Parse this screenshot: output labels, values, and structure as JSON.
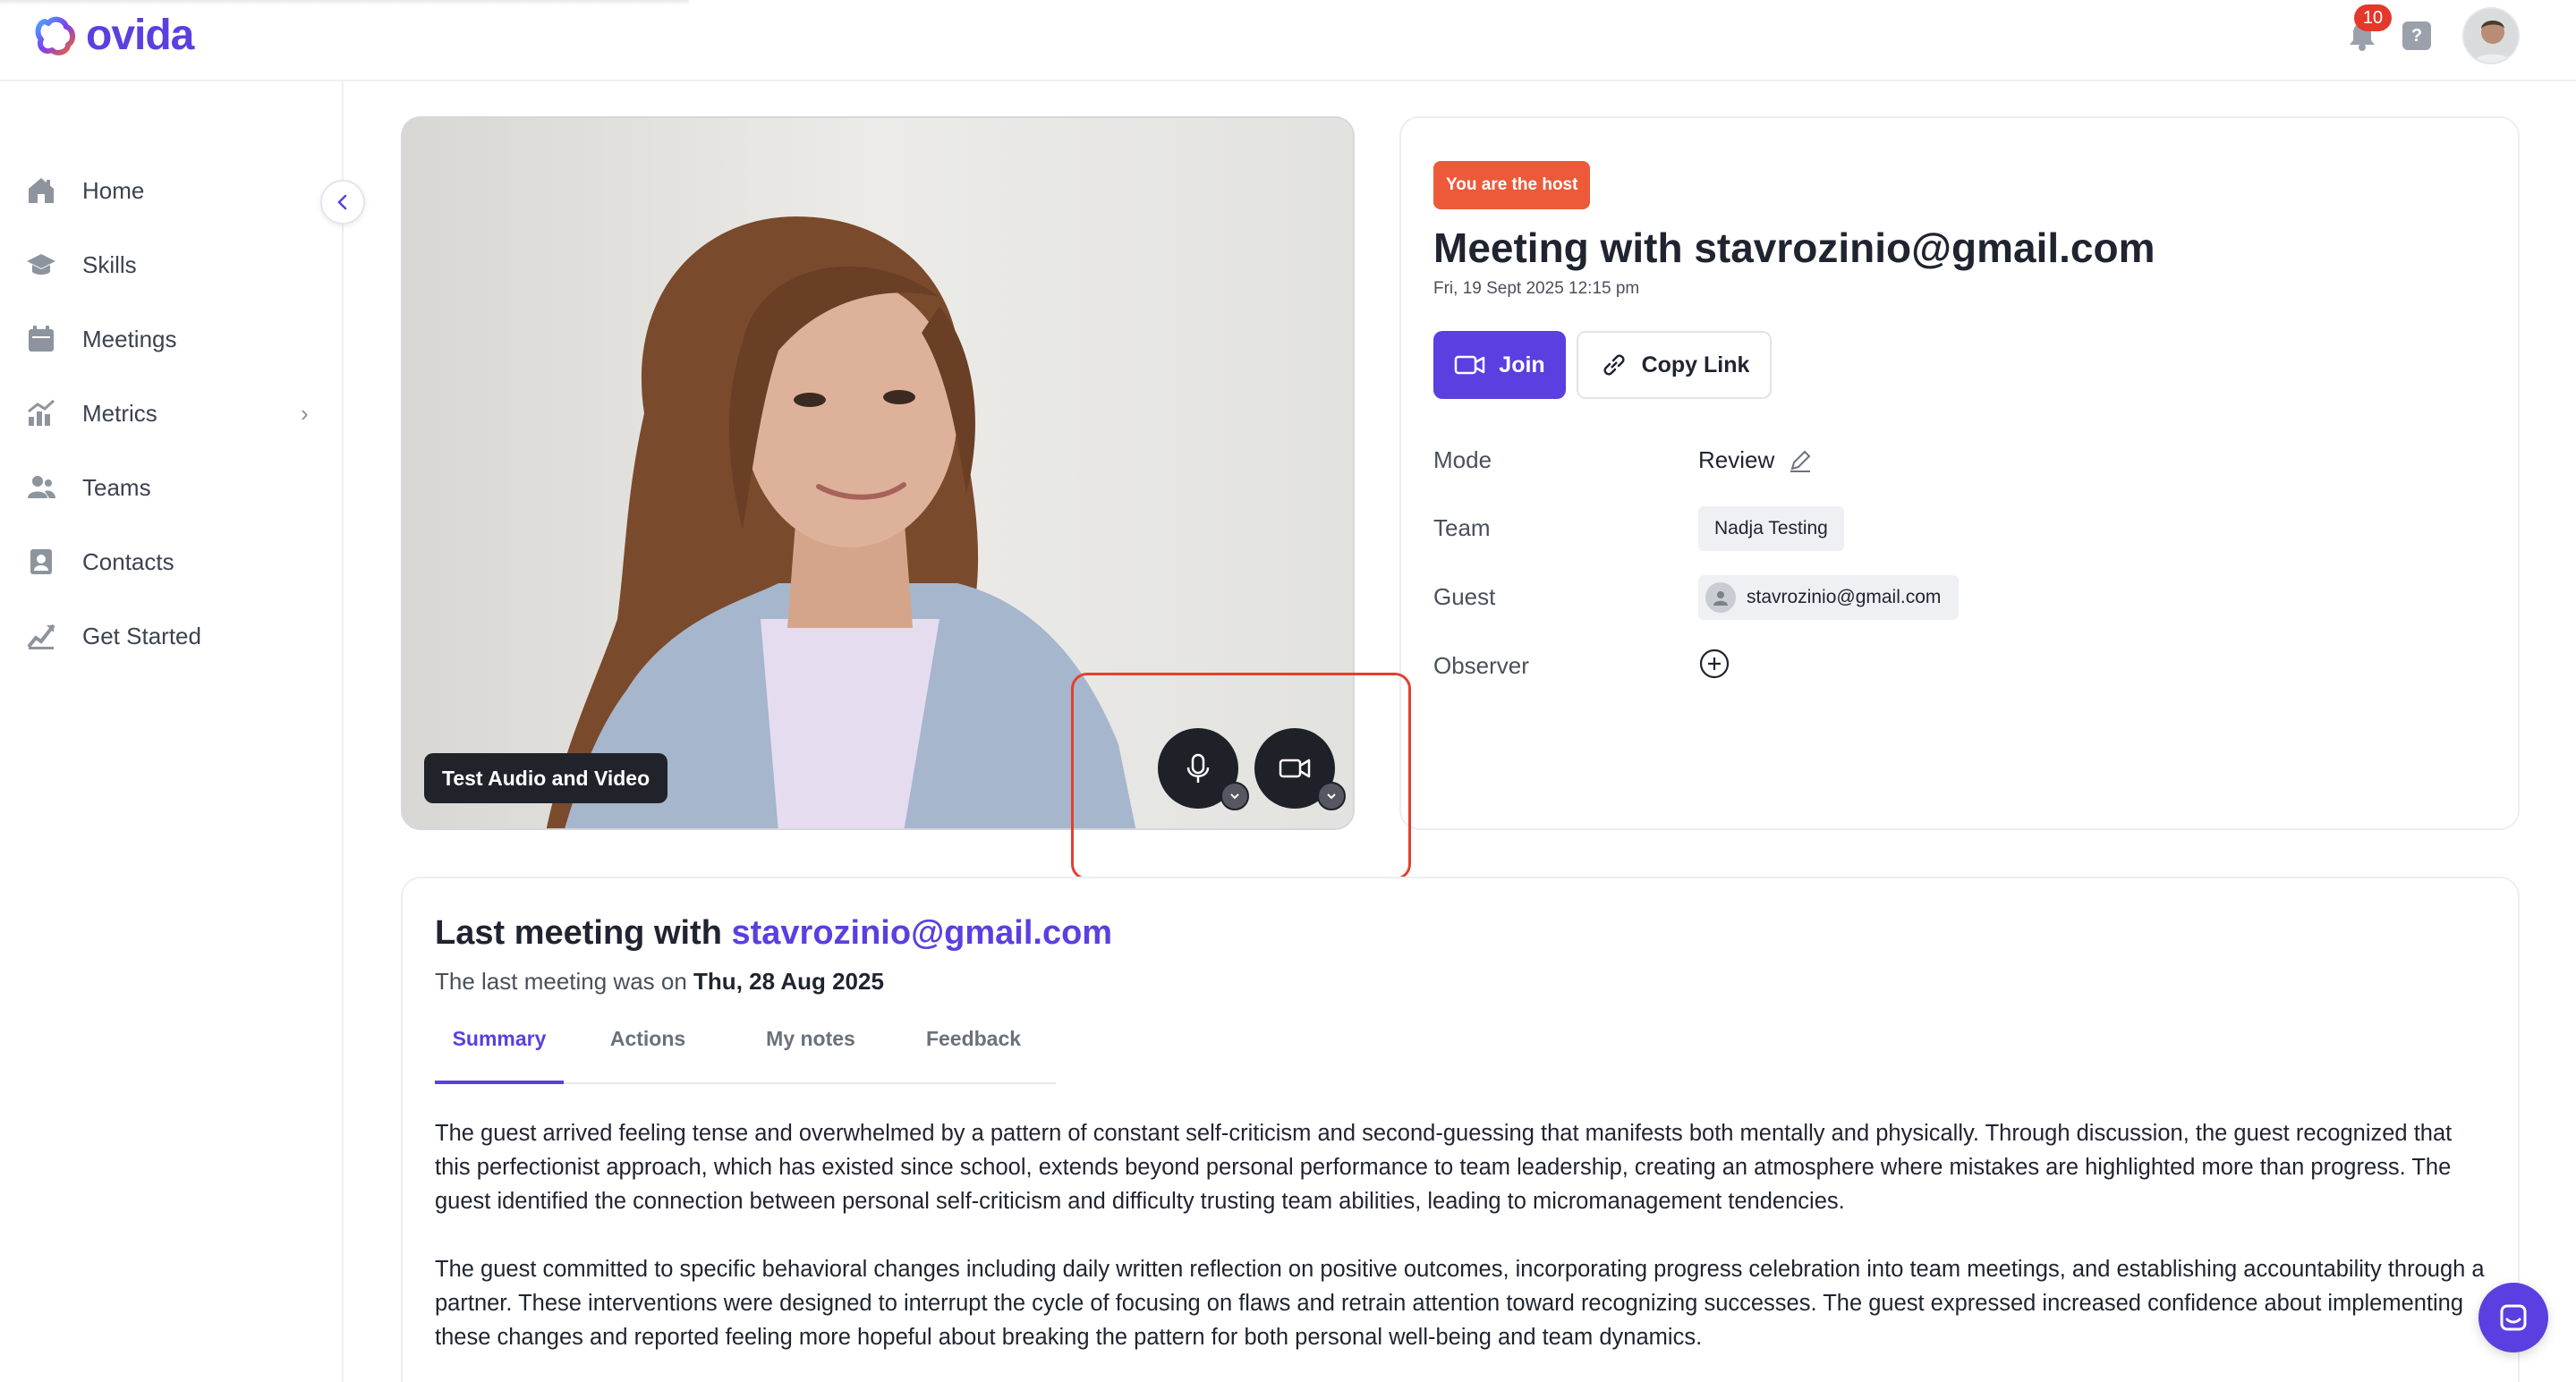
{
  "app": {
    "logo_text": "ovida"
  },
  "header": {
    "notification_count": "10",
    "help_label": "?"
  },
  "sidebar": {
    "items": [
      {
        "label": "Home",
        "icon": "home-icon"
      },
      {
        "label": "Skills",
        "icon": "graduation-cap-icon"
      },
      {
        "label": "Meetings",
        "icon": "calendar-icon"
      },
      {
        "label": "Metrics",
        "icon": "chart-icon",
        "has_submenu": true
      },
      {
        "label": "Teams",
        "icon": "users-icon"
      },
      {
        "label": "Contacts",
        "icon": "contact-card-icon"
      },
      {
        "label": "Get Started",
        "icon": "rocket-icon"
      }
    ]
  },
  "video": {
    "test_label": "Test Audio and Video"
  },
  "meeting": {
    "host_badge": "You are the host",
    "title": "Meeting with stavrozinio@gmail.com",
    "date": "Fri, 19 Sept 2025 12:15 pm",
    "join_label": "Join",
    "copy_link_label": "Copy Link",
    "fields": {
      "mode_label": "Mode",
      "mode_value": "Review",
      "team_label": "Team",
      "team_value": "Nadja Testing",
      "guest_label": "Guest",
      "guest_value": "stavrozinio@gmail.com",
      "observer_label": "Observer"
    }
  },
  "last_meeting": {
    "title_prefix": "Last meeting with",
    "title_email": "stavrozinio@gmail.com",
    "sub_prefix": "The last meeting was on",
    "sub_date": "Thu, 28 Aug 2025",
    "tabs": [
      "Summary",
      "Actions",
      "My notes",
      "Feedback"
    ],
    "active_tab": "Summary",
    "summary_p1": "The guest arrived feeling tense and overwhelmed by a pattern of constant self-criticism and second-guessing that manifests both mentally and physically. Through discussion, the guest recognized that this perfectionist approach, which has existed since school, extends beyond personal performance to team leadership, creating an atmosphere where mistakes are highlighted more than progress. The guest identified the connection between personal self-criticism and difficulty trusting team abilities, leading to micromanagement tendencies.",
    "summary_p2": "The guest committed to specific behavioral changes including daily written reflection on positive outcomes, incorporating progress celebration into team meetings, and establishing accountability through a partner. These interventions were designed to interrupt the cycle of focusing on flaws and retrain attention toward recognizing successes. The guest expressed increased confidence about implementing these changes and reported feeling more hopeful about breaking the pattern for both personal well-being and team dynamics."
  },
  "colors": {
    "brand": "#5b3fe0",
    "host_badge": "#ec5a3a",
    "highlight": "#e2402f"
  }
}
